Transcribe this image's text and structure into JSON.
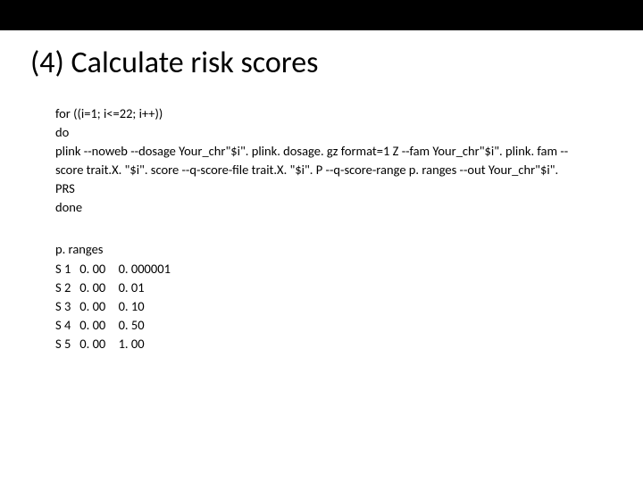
{
  "title": "(4) Calculate risk scores",
  "code": {
    "l1": "for ((i=1; i<=22; i++))",
    "l2": "do",
    "l3": "plink --noweb --dosage Your_chr\"$i\". plink. dosage. gz format=1 Z --fam Your_chr\"$i\". plink. fam --score trait.X. \"$i\". score --q-score-file trait.X. \"$i\". P --q-score-range p. ranges --out Your_chr\"$i\". PRS",
    "l4": "done"
  },
  "ranges": {
    "header": "p. ranges",
    "rows": [
      {
        "label": "S 1",
        "c1": "0. 00",
        "c2": "0. 000001"
      },
      {
        "label": "S 2",
        "c1": "0. 00",
        "c2": "0. 01"
      },
      {
        "label": "S 3",
        "c1": "0. 00",
        "c2": "0. 10"
      },
      {
        "label": "S 4",
        "c1": "0. 00",
        "c2": "0. 50"
      },
      {
        "label": "S 5",
        "c1": "0. 00",
        "c2": "1. 00"
      }
    ]
  }
}
